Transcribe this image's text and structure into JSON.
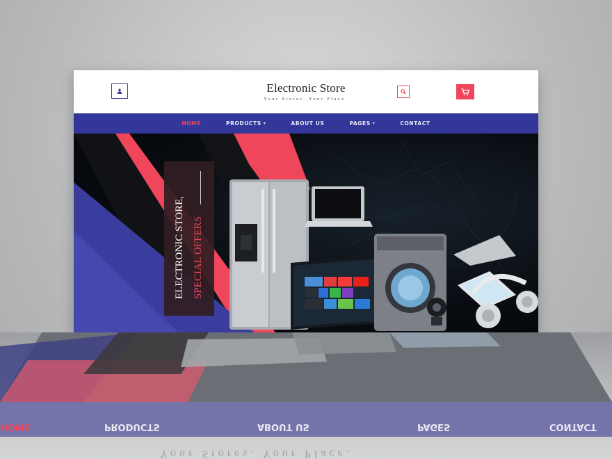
{
  "store": {
    "title": "Electronic Store",
    "tagline": "Your Stores. Your Place."
  },
  "header": {
    "user_icon": "user-icon",
    "search_icon": "search-icon",
    "cart_icon": "cart-icon"
  },
  "nav": {
    "items": [
      {
        "label": "HOME",
        "active": true,
        "dropdown": false
      },
      {
        "label": "PRODUCTS",
        "active": false,
        "dropdown": true
      },
      {
        "label": "ABOUT US",
        "active": false,
        "dropdown": false
      },
      {
        "label": "PAGES",
        "active": false,
        "dropdown": true
      },
      {
        "label": "CONTACT",
        "active": false,
        "dropdown": false
      }
    ],
    "dropdown_glyph": "▾"
  },
  "hero": {
    "promo_title": "ELECTRONIC STORE,",
    "promo_subtitle": "SPECIAL OFFERS",
    "products": [
      "refrigerator",
      "laptop",
      "smart-tv",
      "washing-machine",
      "macbook",
      "webcam",
      "smartphone",
      "headphones"
    ]
  },
  "reflection": {
    "tagline": "Your Stores. Your Place.",
    "nav_labels": [
      "HOME",
      "PRODUCTS",
      "ABOUT US",
      "PAGES",
      "CONTACT"
    ]
  },
  "colors": {
    "accent": "#f0465b",
    "nav_bg": "#34379a",
    "hero_bg": "#080b10",
    "stage_bg": "#b8babc"
  }
}
